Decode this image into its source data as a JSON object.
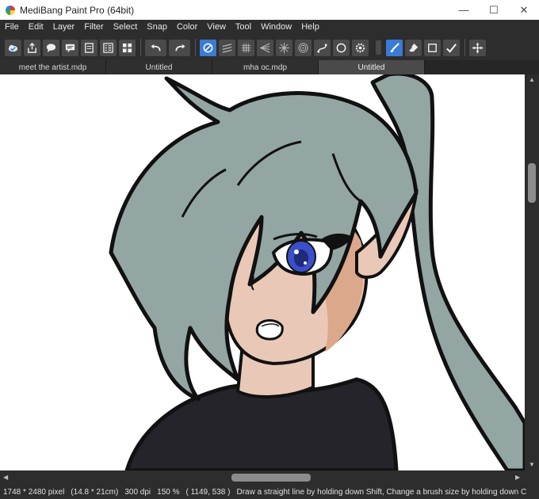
{
  "app": {
    "title": "MediBang Paint Pro (64bit)"
  },
  "window_controls": {
    "minimize": "—",
    "maximize": "☐",
    "close": "✕"
  },
  "menu": [
    "File",
    "Edit",
    "Layer",
    "Filter",
    "Select",
    "Snap",
    "Color",
    "View",
    "Tool",
    "Window",
    "Help"
  ],
  "toolbar": {
    "file_tools": [
      "cloud-save-icon",
      "export-icon",
      "comment-icon",
      "message-icon",
      "page-icon",
      "layer-list-icon",
      "grid-panels-icon"
    ],
    "history": [
      "undo-icon",
      "redo-icon"
    ],
    "snap_tools": [
      "snap-off-icon",
      "parallel-snap-icon",
      "grid-snap-icon",
      "perspective-snap-icon",
      "radial-snap-icon",
      "concentric-snap-icon",
      "curve-snap-icon",
      "circle-snap-icon",
      "snap-settings-icon"
    ],
    "drawing_tools": [
      "brush-icon",
      "eraser-icon",
      "rectangle-select-icon",
      "checkmark-icon",
      "move-icon"
    ]
  },
  "tabs": [
    {
      "label": "meet the artist.mdp",
      "active": false
    },
    {
      "label": "Untitled",
      "active": false
    },
    {
      "label": "mha oc.mdp",
      "active": false
    },
    {
      "label": "Untitled",
      "active": true
    }
  ],
  "colors": {
    "accent": "#3a7bd5",
    "hair": "#94a6a4",
    "skin": "#e9c8b7",
    "skin_shadow": "#dba88c",
    "shirt": "#25242a",
    "eye": "#3b4fc9"
  },
  "status": {
    "size_px": "1748 * 2480 pixel",
    "size_cm": "(14.8 * 21cm)",
    "dpi": "300 dpi",
    "zoom": "150 %",
    "cursor": "( 1149, 538 )",
    "hint": "Draw a straight line by holding down Shift, Change a brush size by holding down C"
  }
}
